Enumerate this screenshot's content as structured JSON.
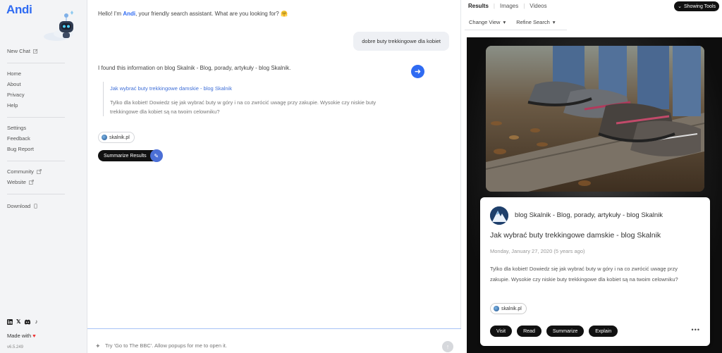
{
  "app": {
    "logo": "Andi",
    "version": "v6.5.249"
  },
  "sidebar": {
    "new_chat": "New Chat",
    "links_a": [
      "Home",
      "About",
      "Privacy",
      "Help"
    ],
    "links_b": [
      "Settings",
      "Feedback",
      "Bug Report"
    ],
    "community": "Community",
    "website": "Website",
    "download": "Download",
    "social_icons": [
      "linkedin-icon",
      "x-icon",
      "discord-icon",
      "tiktok-icon"
    ],
    "made_with": "Made with"
  },
  "chat": {
    "greeting_pre": "Hello! I'm ",
    "greeting_name": "Andi",
    "greeting_post": ", your friendly search assistant. What are you looking for? 🤗",
    "user_message": "dobre buty trekkingowe dla kobiet",
    "bot_intro": "I found this information on blog Skalnik - Blog, porady, artykuły - blog Skalnik.",
    "quote_link": "Jak wybrać buty trekkingowe damskie - blog Skalnik",
    "quote_desc": "Tylko dla kobiet! Dowiedz się jak wybrać buty w góry i na co zwrócić uwagę przy zakupie. Wysokie czy niskie buty trekkingowe dla kobiet są na twoim celowniku?",
    "source_chip": "skalnik.pl",
    "summarize_label": "Summarize Results",
    "input_placeholder": "Try 'Go to The BBC'. Allow popups for me to open it."
  },
  "results": {
    "tabs": [
      "Results",
      "Images",
      "Videos"
    ],
    "tools_label": "Showing Tools",
    "change_view": "Change View",
    "refine_search": "Refine Search",
    "card": {
      "source_name": "blog Skalnik - Blog, porady, artykuły - blog Skalnik",
      "title": "Jak wybrać buty trekkingowe damskie - blog Skalnik",
      "date": "Monday, January 27, 2020 (5 years ago)",
      "description": "Tylko dla kobiet! Dowiedz się jak wybrać buty w góry i na co zwrócić uwagę przy zakupie. Wysokie czy niskie buty trekkingowe dla kobiet są na twoim celowniku?",
      "chip": "skalnik.pl",
      "actions": [
        "Visit",
        "Read",
        "Summarize",
        "Explain"
      ]
    }
  },
  "colors": {
    "accent": "#2f6bf2",
    "dark": "#111111"
  }
}
